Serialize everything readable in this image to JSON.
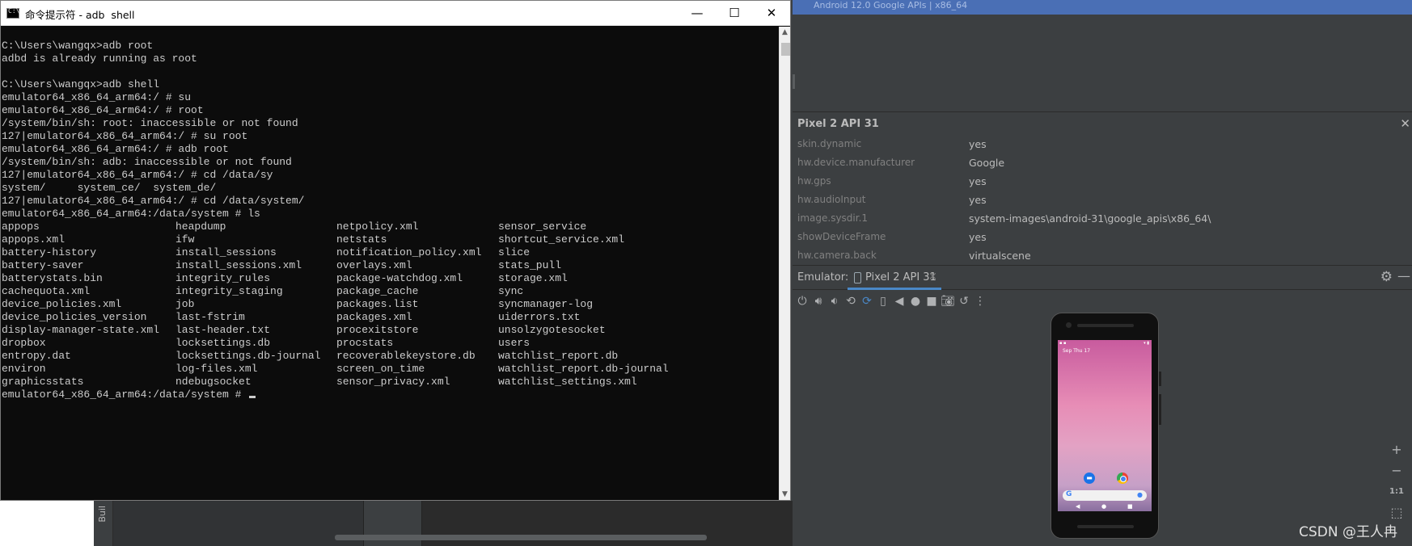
{
  "cmd": {
    "title": "命令提示符 - adb  shell",
    "icon_text": "C:\\",
    "window_buttons": {
      "minimize": "—",
      "maximize": "☐",
      "close": "✕"
    },
    "lines": [
      "",
      "C:\\Users\\wangqx>adb root",
      "adbd is already running as root",
      "",
      "C:\\Users\\wangqx>adb shell",
      "emulator64_x86_64_arm64:/ # su",
      "emulator64_x86_64_arm64:/ # root",
      "/system/bin/sh: root: inaccessible or not found",
      "127|emulator64_x86_64_arm64:/ # su root",
      "emulator64_x86_64_arm64:/ # adb root",
      "/system/bin/sh: adb: inaccessible or not found",
      "127|emulator64_x86_64_arm64:/ # cd /data/sy",
      "system/     system_ce/  system_de/",
      "127|emulator64_x86_64_arm64:/ # cd /data/system/",
      "emulator64_x86_64_arm64:/data/system # ls"
    ],
    "ls_columns": [
      [
        "appops",
        "appops.xml",
        "battery-history",
        "battery-saver",
        "batterystats.bin",
        "cachequota.xml",
        "device_policies.xml",
        "device_policies_version",
        "display-manager-state.xml",
        "dropbox",
        "entropy.dat",
        "environ",
        "graphicsstats"
      ],
      [
        "heapdump",
        "ifw",
        "install_sessions",
        "install_sessions.xml",
        "integrity_rules",
        "integrity_staging",
        "job",
        "last-fstrim",
        "last-header.txt",
        "locksettings.db",
        "locksettings.db-journal",
        "log-files.xml",
        "ndebugsocket"
      ],
      [
        "netpolicy.xml",
        "netstats",
        "notification_policy.xml",
        "overlays.xml",
        "package-watchdog.xml",
        "package_cache",
        "packages.list",
        "packages.xml",
        "procexitstore",
        "procstats",
        "recoverablekeystore.db",
        "screen_on_time",
        "sensor_privacy.xml"
      ],
      [
        "sensor_service",
        "shortcut_service.xml",
        "slice",
        "stats_pull",
        "storage.xml",
        "sync",
        "syncmanager-log",
        "uiderrors.txt",
        "unsolzygotesocket",
        "users",
        "watchlist_report.db",
        "watchlist_report.db-journal",
        "watchlist_settings.xml"
      ]
    ],
    "final_prompt": "emulator64_x86_64_arm64:/data/system # "
  },
  "studio": {
    "top_banner": "Android 12.0 Google APIs | x86_64",
    "build_tab": "Buil",
    "props_title": "Pixel 2 API 31",
    "props": [
      {
        "key": "skin.dynamic",
        "value": "yes"
      },
      {
        "key": "hw.device.manufacturer",
        "value": "Google"
      },
      {
        "key": "hw.gps",
        "value": "yes"
      },
      {
        "key": "hw.audioInput",
        "value": "yes"
      },
      {
        "key": "image.sysdir.1",
        "value": "system-images\\android-31\\google_apis\\x86_64\\"
      },
      {
        "key": "showDeviceFrame",
        "value": "yes"
      },
      {
        "key": "hw.camera.back",
        "value": "virtualscene"
      }
    ],
    "emulator_label": "Emulator:",
    "emulator_tab": "Pixel 2 API 31",
    "emulator_tab_close": "×",
    "zoom": {
      "in": "+",
      "out": "−",
      "ratio": "1:1"
    },
    "phone_date": "Sep Thu 17"
  },
  "watermark": "CSDN @王人冉"
}
